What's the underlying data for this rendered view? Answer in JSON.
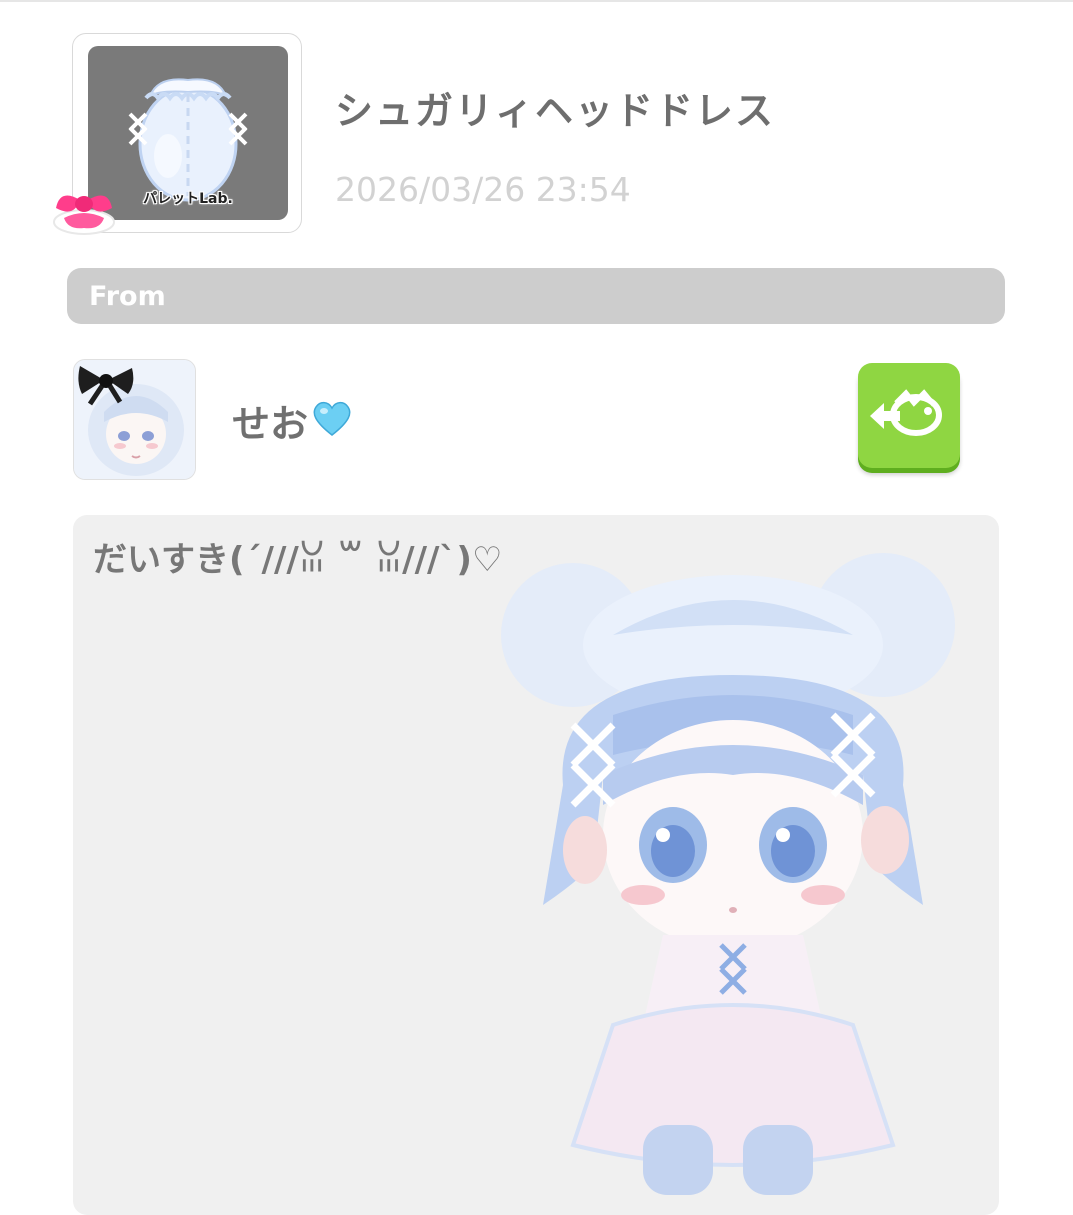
{
  "item": {
    "title": "シュガリィヘッドドレス",
    "date": "2026/03/26 23:54",
    "brand_label": "パレットLab.",
    "thumb_bg": "#7a7a7a",
    "badge_icon": "pink-ribbon-icon"
  },
  "from_section": {
    "label": "From"
  },
  "sender": {
    "name": "せお",
    "name_emoji_icon": "light-blue-heart-icon",
    "avatar_icon": "user-avatar",
    "visit_button_icon": "room-visit-arrow-icon",
    "visit_button_color": "#8fd642"
  },
  "message": {
    "text": "だいすき(´///ꈍ ꒳ ꈍ///`)♡",
    "card_bg": "#f0f0f0",
    "background_art": "character-avatar-illustration"
  }
}
